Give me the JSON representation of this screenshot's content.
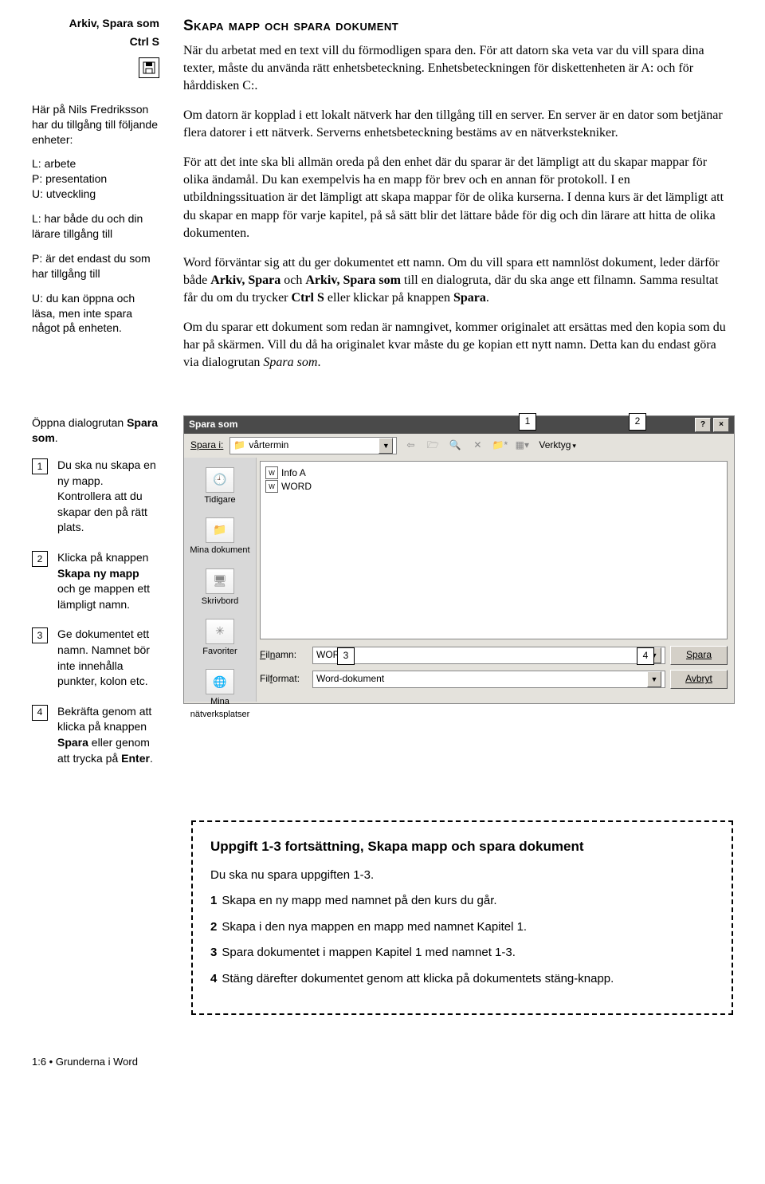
{
  "side": {
    "menu_path": "Arkiv, Spara som",
    "shortcut": "Ctrl S",
    "intro": "Här på Nils Fredriksson har du tillgång till följande enheter:",
    "drives": "L: arbete\nP: presentation\nU: utveckling",
    "l_note": "L: har både du och din lärare tillgång till",
    "p_note": "P: är det endast du som har tillgång till",
    "u_note": "U: du kan öppna och läsa, men inte spara något på enheten."
  },
  "main": {
    "heading": "Skapa mapp och spara dokument",
    "p1": "När du arbetat med en text vill du förmodligen spara den. För att datorn ska veta var du vill spara dina texter, måste du använda rätt enhetsbeteckning. Enhetsbeteckningen för diskettenheten är A: och för hårddisken C:.",
    "p2": "Om datorn är kopplad i ett lokalt nätverk har den tillgång till en server. En server är en dator som betjänar flera datorer i ett nätverk. Serverns enhetsbeteckning bestäms av en nätverkstekniker.",
    "p3": "För att det inte ska bli allmän oreda på den enhet där du sparar är det lämpligt att du skapar mappar för olika ändamål. Du kan exempelvis ha en mapp för brev och en annan för protokoll. I en utbildningssituation är det lämpligt att skapa mappar för de olika kurserna. I denna kurs är det lämpligt att du skapar en mapp för varje kapitel, på så sätt blir det lättare både för dig och din lärare att hitta de olika dokumenten.",
    "p4_a": "Word förväntar sig att du ger dokumentet ett namn. Om du vill spara ett namnlöst dokument, leder därför både ",
    "p4_b": "Arkiv, Spara",
    "p4_c": " och ",
    "p4_d": "Arkiv, Spara som",
    "p4_e": " till en dialogruta, där du ska ange ett filnamn. Samma resultat får du om du trycker ",
    "p4_f": "Ctrl S",
    "p4_g": " eller klickar på knappen ",
    "p4_h": "Spara",
    "p4_i": ".",
    "p5_a": "Om du sparar ett dokument som redan är namngivet, kommer originalet att ersättas med den kopia som du har på skärmen. Vill du då ha originalet kvar måste du ge kopian ett nytt namn. Detta kan du endast göra via dialogrutan ",
    "p5_b": "Spara som",
    "p5_c": "."
  },
  "steps": {
    "intro_a": "Öppna dialogrutan ",
    "intro_b": "Spara som",
    "intro_c": ".",
    "s1": "Du ska nu skapa en ny mapp. Kontrollera att du skapar den på rätt plats.",
    "s2_a": "Klicka på knappen ",
    "s2_b": "Skapa ny mapp",
    "s2_c": " och ge mappen ett lämpligt namn.",
    "s3": "Ge dokumentet ett namn. Namnet bör inte innehålla punkter, kolon etc.",
    "s4_a": "Bekräfta genom att klicka på knappen ",
    "s4_b": "Spara",
    "s4_c": " eller genom att trycka på ",
    "s4_d": "Enter",
    "s4_e": ".",
    "n1": "1",
    "n2": "2",
    "n3": "3",
    "n4": "4"
  },
  "dialog": {
    "title": "Spara som",
    "spara_i_label": "Spara i:",
    "spara_i_value": "vårtermin",
    "verktyg": "Verktyg",
    "places": {
      "tidigare": "Tidigare",
      "mina_dok": "Mina dokument",
      "skrivbord": "Skrivbord",
      "favoriter": "Favoriter",
      "mina_nat": "Mina nätverksplatser"
    },
    "file1": "Info A",
    "file2": "WORD",
    "filnamn_label": "Filnamn:",
    "filnamn_value": "WORD",
    "filformat_label": "Filformat:",
    "filformat_value": "Word-dokument",
    "btn_spara": "Spara",
    "btn_avbryt": "Avbryt",
    "co1": "1",
    "co2": "2",
    "co3": "3",
    "co4": "4"
  },
  "exercise": {
    "title": "Uppgift 1-3 fortsättning, Skapa mapp och spara dokument",
    "intro": "Du ska nu spara uppgiften 1-3.",
    "l1": "Skapa en ny mapp med namnet på den kurs du går.",
    "l2": "Skapa i den nya mappen en mapp med namnet Kapitel 1.",
    "l3": "Spara dokumentet i mappen Kapitel 1 med namnet 1-3.",
    "l4": "Stäng därefter dokumentet genom att klicka på dokumentets stäng-knapp.",
    "n1": "1",
    "n2": "2",
    "n3": "3",
    "n4": "4"
  },
  "footer": "1:6 • Grunderna i Word"
}
